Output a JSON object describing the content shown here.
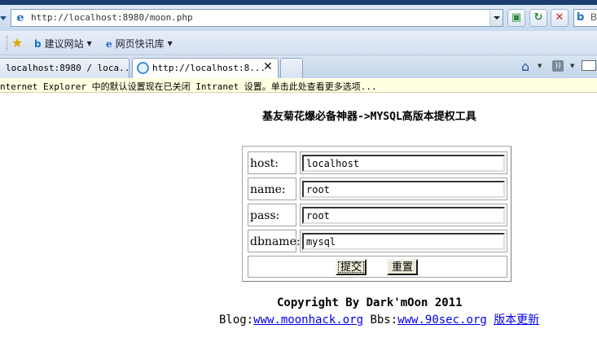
{
  "browser": {
    "address_url": "http://localhost:8980/moon.php",
    "favorites": {
      "suggested_sites": "建议网站",
      "web_slice_gallery": "网页快讯库"
    },
    "search_provider_text": "B",
    "tabs": [
      {
        "title": "localhost:8980 / loca..."
      },
      {
        "title": "http://localhost:8..."
      }
    ],
    "info_bar": "nternet Explorer 中的默认设置现在已关闭 Intranet 设置。单击此处查看更多选项..."
  },
  "page": {
    "heading": "基友菊花爆必备神器->MYSQL高版本提权工具",
    "form": {
      "fields": [
        {
          "label": "host:",
          "value": "localhost"
        },
        {
          "label": "name:",
          "value": "root"
        },
        {
          "label": "pass:",
          "value": "root"
        },
        {
          "label": "dbname:",
          "value": "mysql"
        }
      ],
      "submit_label": "提交",
      "reset_label": "重置"
    },
    "footer": {
      "copyright": "Copyright By Dark'mOon 2011",
      "blog_prefix": "Blog:",
      "blog_link": "www.moonhack.org",
      "bbs_prefix": " Bbs:",
      "bbs_link": "www.90sec.org",
      "update_link": "版本更新"
    }
  },
  "icons": {
    "ie": "ie-logo-icon",
    "bing": "bing-icon",
    "home": "home-icon",
    "rss": "rss-feed-icon",
    "mail": "mail-icon"
  }
}
